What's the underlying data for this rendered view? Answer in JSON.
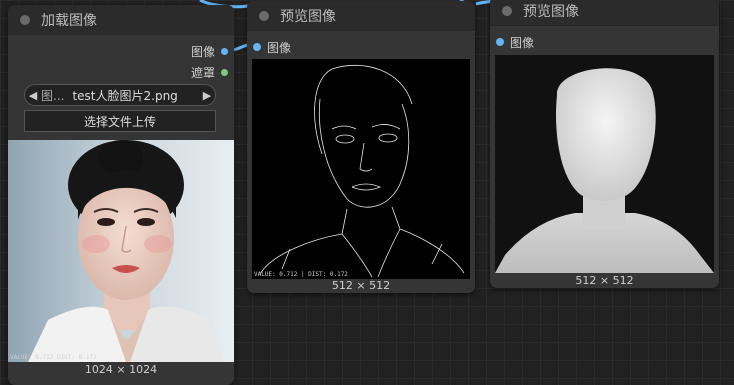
{
  "load_node": {
    "title": "加载图像",
    "outputs": [
      {
        "label": "图像",
        "color": "#64b5f6"
      },
      {
        "label": "遮罩",
        "color": "#81c784"
      }
    ],
    "file_combo": {
      "prefix": "图...",
      "value": "test人脸图片2.png",
      "left_arrow": "◀",
      "right_arrow": "▶"
    },
    "upload_label": "选择文件上传",
    "image_overlay": "VALUE: 0.712   DIST: 0.172",
    "image_size": "1024 × 1024"
  },
  "preview_node_1": {
    "title": "预览图像",
    "input_label": "图像",
    "image_overlay": "VALUE: 0.712 | DIST: 0.172",
    "image_size": "512 × 512"
  },
  "preview_node_2": {
    "title": "预览图像",
    "input_label": "图像",
    "image_size": "512 × 512"
  },
  "colors": {
    "image_link": "#64b5f6",
    "mask_link": "#81c784",
    "canvas_bg": "#212121",
    "node_bg": "#353535",
    "node_title_bg": "#2b2b2b"
  }
}
